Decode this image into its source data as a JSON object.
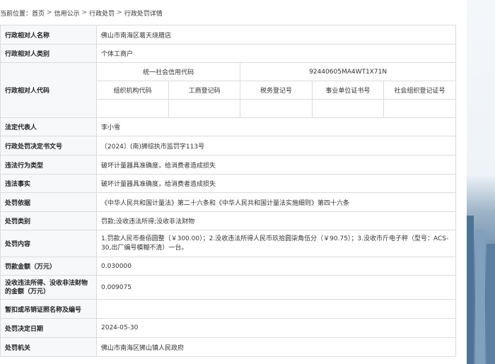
{
  "breadcrumb": {
    "prefix": "当前位置：",
    "items": [
      "首页",
      "信用公示",
      "行政处罚",
      "行政处罚详情"
    ],
    "separator": ">"
  },
  "rows": {
    "party_name": {
      "label": "行政相对人名称",
      "value": "佛山市南海区葛天烧腊店"
    },
    "party_type": {
      "label": "行政相对人类别",
      "value": "个体工商户"
    },
    "party_code": {
      "label": "行政相对人代码",
      "credit_code_label": "统一社会信用代码",
      "credit_code_value": "92440605MA4WT1X71N",
      "sub_headers": [
        "组织机构代码",
        "工商登记码",
        "税务登记号",
        "事业单位证书号",
        "社会组织登记证号"
      ],
      "sub_values": [
        "",
        "",
        "",
        "",
        ""
      ]
    },
    "legal_rep": {
      "label": "法定代表人",
      "value": "李小雪"
    },
    "doc_no": {
      "label": "行政处罚决定书文号",
      "value": "〔2024〕(南)狮综执市监罚字113号"
    },
    "violation_type": {
      "label": "违法行为类型",
      "value": "破坏计量器具准确度，给消费者造成损失"
    },
    "violation_facts": {
      "label": "违法事实",
      "value": "破坏计量器具准确度，给消费者造成损失"
    },
    "basis": {
      "label": "处罚依据",
      "value": "《中华人民共和国计量法》第二十六条和《中华人民共和国计量法实施细则》第四十六条"
    },
    "penalty_category": {
      "label": "处罚类别",
      "value": "罚款;没收违法所得;没收非法财物"
    },
    "penalty_content": {
      "label": "处罚内容",
      "value": "1.罚款人民币叁佰圆整（￥300.00）；2.没收违法所得人民币玖拾圆柒角伍分（￥90.75）；3.没收市斤电子秤（型号：ACS-30,出厂编号模糊不清）一台。"
    },
    "fine_amount": {
      "label": "罚款金额（万元）",
      "value": "0.030000"
    },
    "confiscated_amount": {
      "label": "没收违法所得、没收非法财物的金额（万元）",
      "value": "0.009075"
    },
    "license_revoke": {
      "label": "暂扣或吊销证照名称及编号",
      "value": ""
    },
    "decision_date": {
      "label": "处罚决定日期",
      "value": "2024-05-30"
    },
    "authority": {
      "label": "处罚机关",
      "value": "佛山市南海区狮山镇人民政府"
    }
  }
}
